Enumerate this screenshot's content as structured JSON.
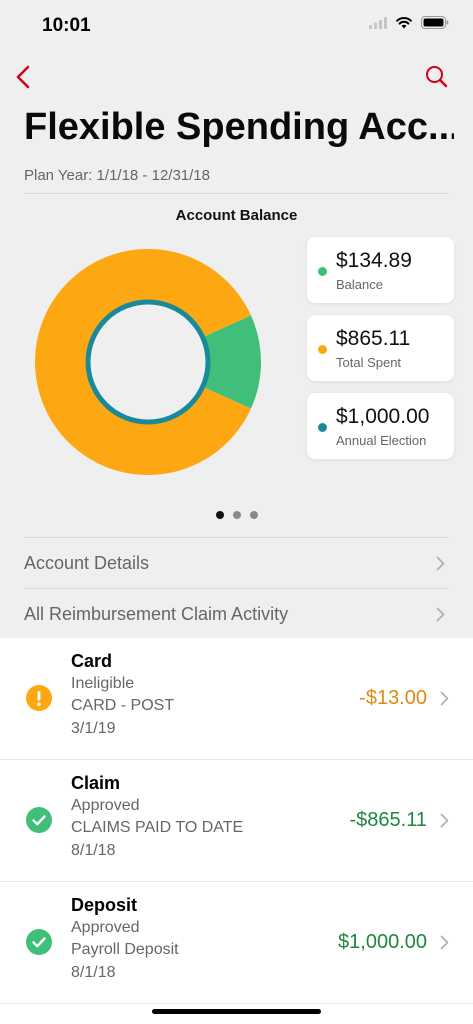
{
  "status_bar": {
    "time": "10:01"
  },
  "header": {
    "title": "Flexible Spending Acc...",
    "plan_year": "Plan Year:  1/1/18 - 12/31/18"
  },
  "colors": {
    "accent": "#d0021b",
    "orange": "#fda813",
    "green": "#3fbf7a",
    "teal": "#1a8a98",
    "positive_text": "#1e8740",
    "negative_text": "#e08a10"
  },
  "chart": {
    "title": "Account Balance"
  },
  "chart_data": {
    "type": "pie",
    "title": "Account Balance",
    "slices": [
      {
        "name": "Balance",
        "value": 134.89,
        "color": "#3fbf7a"
      },
      {
        "name": "Total Spent",
        "value": 865.11,
        "color": "#fda813"
      }
    ],
    "total": {
      "name": "Annual Election",
      "value": 1000.0,
      "color": "#1a8a98"
    }
  },
  "legend": [
    {
      "amount": "$134.89",
      "label": "Balance",
      "color": "#3fbf7a"
    },
    {
      "amount": "$865.11",
      "label": "Total Spent",
      "color": "#fda813"
    },
    {
      "amount": "$1,000.00",
      "label": "Annual Election",
      "color": "#1a8a98"
    }
  ],
  "pager": {
    "count": 3,
    "active": 0
  },
  "links": [
    {
      "label": "Account Details"
    },
    {
      "label": "All Reimbursement Claim Activity"
    }
  ],
  "transactions": [
    {
      "title": "Card",
      "status": "Ineligible",
      "description": "CARD - POST",
      "date": "3/1/19",
      "amount": "-$13.00",
      "icon": "warning-icon"
    },
    {
      "title": "Claim",
      "status": "Approved",
      "description": "CLAIMS PAID TO DATE",
      "date": "8/1/18",
      "amount": "-$865.11",
      "icon": "checkmark-icon"
    },
    {
      "title": "Deposit",
      "status": "Approved",
      "description": "Payroll Deposit",
      "date": "8/1/18",
      "amount": "$1,000.00",
      "icon": "checkmark-icon"
    }
  ]
}
